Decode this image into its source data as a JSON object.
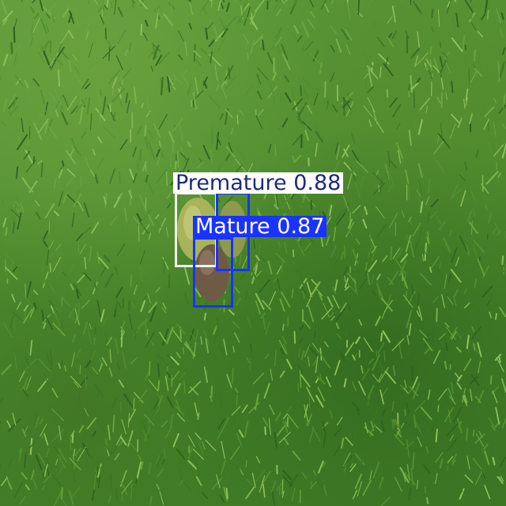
{
  "detections": [
    {
      "label": "Premature",
      "score": "0.88",
      "color": "#ffffff",
      "text_color": "#1e2a78"
    },
    {
      "label": "Mature",
      "score": "0.87",
      "color": "#1a33ff",
      "text_color": "#ffffff"
    }
  ]
}
